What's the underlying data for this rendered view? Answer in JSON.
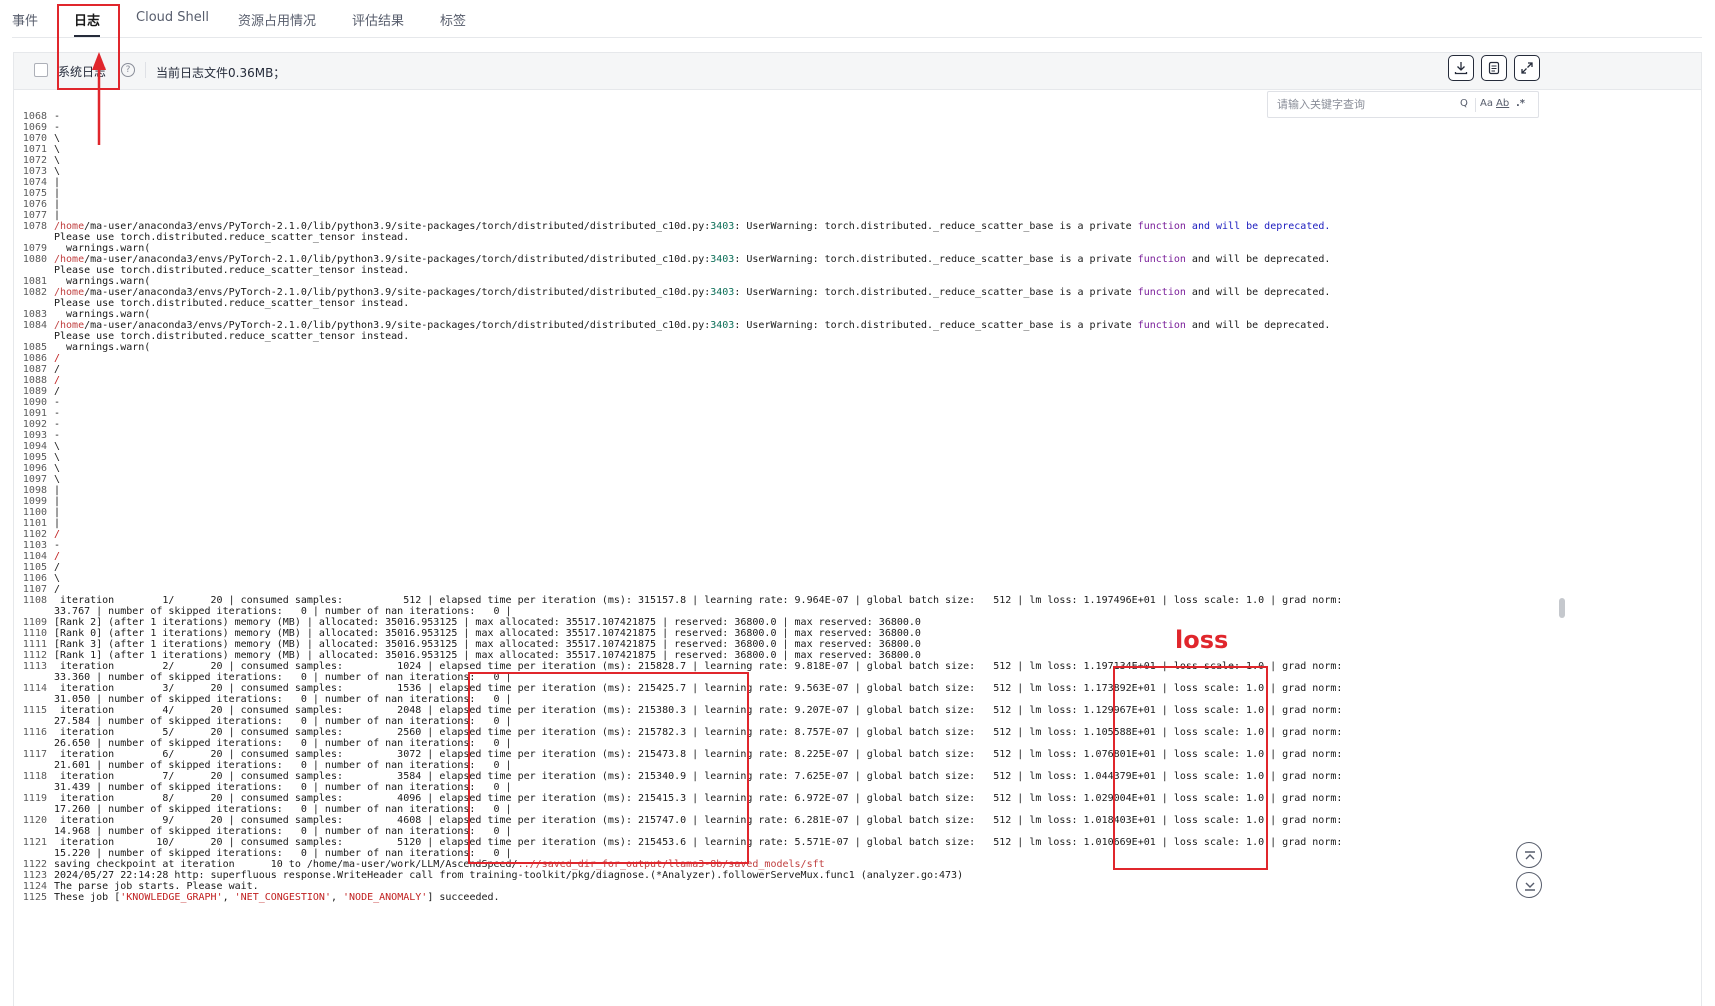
{
  "tabs": [
    "事件",
    "日志",
    "Cloud Shell",
    "资源占用情况",
    "评估结果",
    "标签"
  ],
  "active_tab": "日志",
  "toolbar": {
    "system_log_label": "系统日志",
    "help_icon": "?",
    "log_size_label": "当前日志文件0.36MB；",
    "download_icon": "download-icon",
    "copy_icon": "copy-icon",
    "fullscreen_icon": "fullscreen-icon"
  },
  "search": {
    "placeholder": "请输入关键字查询",
    "search_icon": "Q",
    "match_case_label": "Aa",
    "whole_word_label": "Ab",
    "regex_label": ".*"
  },
  "annotation": {
    "loss_label": "loss",
    "highlight_color": "#e0262c"
  },
  "log_lines": [
    {
      "n": "1068",
      "t": "-"
    },
    {
      "n": "1069",
      "t": "-"
    },
    {
      "n": "1070",
      "t": "\\"
    },
    {
      "n": "1071",
      "t": "\\"
    },
    {
      "n": "1072",
      "t": "\\"
    },
    {
      "n": "1073",
      "t": "\\"
    },
    {
      "n": "1074",
      "t": "|"
    },
    {
      "n": "1075",
      "t": "|"
    },
    {
      "n": "1076",
      "t": "|"
    },
    {
      "n": "1077",
      "t": "|"
    },
    {
      "n": "1078",
      "t": "/home/ma-user/anaconda3/envs/PyTorch-2.1.0/lib/python3.9/site-packages/torch/distributed/distributed_c10d.py:3403: UserWarning: torch.distributed._reduce_scatter_base is a private function and will be deprecated.",
      "kind": "warn_full"
    },
    {
      "n": "",
      "t": "Please use torch.distributed.reduce_scatter_tensor instead."
    },
    {
      "n": "1079",
      "t": "  warnings.warn("
    },
    {
      "n": "1080",
      "t": "/home/ma-user/anaconda3/envs/PyTorch-2.1.0/lib/python3.9/site-packages/torch/distributed/distributed_c10d.py:3403: UserWarning: torch.distributed._reduce_scatter_base is a private function and will be deprecated.",
      "kind": "warn"
    },
    {
      "n": "",
      "t": "Please use torch.distributed.reduce_scatter_tensor instead."
    },
    {
      "n": "1081",
      "t": "  warnings.warn("
    },
    {
      "n": "1082",
      "t": "/home/ma-user/anaconda3/envs/PyTorch-2.1.0/lib/python3.9/site-packages/torch/distributed/distributed_c10d.py:3403: UserWarning: torch.distributed._reduce_scatter_base is a private function and will be deprecated.",
      "kind": "warn"
    },
    {
      "n": "",
      "t": "Please use torch.distributed.reduce_scatter_tensor instead."
    },
    {
      "n": "1083",
      "t": "  warnings.warn("
    },
    {
      "n": "1084",
      "t": "/home/ma-user/anaconda3/envs/PyTorch-2.1.0/lib/python3.9/site-packages/torch/distributed/distributed_c10d.py:3403: UserWarning: torch.distributed._reduce_scatter_base is a private function and will be deprecated.",
      "kind": "warn"
    },
    {
      "n": "",
      "t": "Please use torch.distributed.reduce_scatter_tensor instead."
    },
    {
      "n": "1085",
      "t": "  warnings.warn("
    },
    {
      "n": "1086",
      "t": "/",
      "kind": "red"
    },
    {
      "n": "1087",
      "t": "/"
    },
    {
      "n": "1088",
      "t": "/",
      "kind": "red"
    },
    {
      "n": "1089",
      "t": "/"
    },
    {
      "n": "1090",
      "t": "-"
    },
    {
      "n": "1091",
      "t": "-"
    },
    {
      "n": "1092",
      "t": "-"
    },
    {
      "n": "1093",
      "t": "-"
    },
    {
      "n": "1094",
      "t": "\\"
    },
    {
      "n": "1095",
      "t": "\\"
    },
    {
      "n": "1096",
      "t": "\\"
    },
    {
      "n": "1097",
      "t": "\\"
    },
    {
      "n": "1098",
      "t": "|"
    },
    {
      "n": "1099",
      "t": "|"
    },
    {
      "n": "1100",
      "t": "|"
    },
    {
      "n": "1101",
      "t": "|"
    },
    {
      "n": "1102",
      "t": "/",
      "kind": "red"
    },
    {
      "n": "1103",
      "t": "-"
    },
    {
      "n": "1104",
      "t": "/",
      "kind": "red"
    },
    {
      "n": "1105",
      "t": "/"
    },
    {
      "n": "1106",
      "t": "\\"
    },
    {
      "n": "1107",
      "t": "/"
    },
    {
      "n": "1108",
      "t": " iteration        1/      20 | consumed samples:          512 | elapsed time per iteration (ms): 315157.8 | learning rate: 9.964E-07 | global batch size:   512 | lm loss: 1.197496E+01 | loss scale: 1.0 | grad norm:"
    },
    {
      "n": "",
      "t": "33.767 | number of skipped iterations:   0 | number of nan iterations:   0 |"
    },
    {
      "n": "1109",
      "t": "[Rank 2] (after 1 iterations) memory (MB) | allocated: 35016.953125 | max allocated: 35517.107421875 | reserved: 36800.0 | max reserved: 36800.0"
    },
    {
      "n": "1110",
      "t": "[Rank 0] (after 1 iterations) memory (MB) | allocated: 35016.953125 | max allocated: 35517.107421875 | reserved: 36800.0 | max reserved: 36800.0"
    },
    {
      "n": "1111",
      "t": "[Rank 3] (after 1 iterations) memory (MB) | allocated: 35016.953125 | max allocated: 35517.107421875 | reserved: 36800.0 | max reserved: 36800.0"
    },
    {
      "n": "1112",
      "t": "[Rank 1] (after 1 iterations) memory (MB) | allocated: 35016.953125 | max allocated: 35517.107421875 | reserved: 36800.0 | max reserved: 36800.0"
    },
    {
      "n": "1113",
      "t": " iteration        2/      20 | consumed samples:         1024 | elapsed time per iteration (ms): 215828.7 | learning rate: 9.818E-07 | global batch size:   512 | lm loss: 1.197134E+01 | loss scale: 1.0 | grad norm:"
    },
    {
      "n": "",
      "t": "33.360 | number of skipped iterations:   0 | number of nan iterations:   0 |"
    },
    {
      "n": "1114",
      "t": " iteration        3/      20 | consumed samples:         1536 | elapsed time per iteration (ms): 215425.7 | learning rate: 9.563E-07 | global batch size:   512 | lm loss: 1.173892E+01 | loss scale: 1.0 | grad norm:"
    },
    {
      "n": "",
      "t": "31.050 | number of skipped iterations:   0 | number of nan iterations:   0 |"
    },
    {
      "n": "1115",
      "t": " iteration        4/      20 | consumed samples:         2048 | elapsed time per iteration (ms): 215380.3 | learning rate: 9.207E-07 | global batch size:   512 | lm loss: 1.129967E+01 | loss scale: 1.0 | grad norm:"
    },
    {
      "n": "",
      "t": "27.584 | number of skipped iterations:   0 | number of nan iterations:   0 |"
    },
    {
      "n": "1116",
      "t": " iteration        5/      20 | consumed samples:         2560 | elapsed time per iteration (ms): 215782.3 | learning rate: 8.757E-07 | global batch size:   512 | lm loss: 1.105588E+01 | loss scale: 1.0 | grad norm:"
    },
    {
      "n": "",
      "t": "26.650 | number of skipped iterations:   0 | number of nan iterations:   0 |"
    },
    {
      "n": "1117",
      "t": " iteration        6/      20 | consumed samples:         3072 | elapsed time per iteration (ms): 215473.8 | learning rate: 8.225E-07 | global batch size:   512 | lm loss: 1.076801E+01 | loss scale: 1.0 | grad norm:"
    },
    {
      "n": "",
      "t": "21.601 | number of skipped iterations:   0 | number of nan iterations:   0 |"
    },
    {
      "n": "1118",
      "t": " iteration        7/      20 | consumed samples:         3584 | elapsed time per iteration (ms): 215340.9 | learning rate: 7.625E-07 | global batch size:   512 | lm loss: 1.044379E+01 | loss scale: 1.0 | grad norm:"
    },
    {
      "n": "",
      "t": "31.439 | number of skipped iterations:   0 | number of nan iterations:   0 |"
    },
    {
      "n": "1119",
      "t": " iteration        8/      20 | consumed samples:         4096 | elapsed time per iteration (ms): 215415.3 | learning rate: 6.972E-07 | global batch size:   512 | lm loss: 1.029004E+01 | loss scale: 1.0 | grad norm:"
    },
    {
      "n": "",
      "t": "17.260 | number of skipped iterations:   0 | number of nan iterations:   0 |"
    },
    {
      "n": "1120",
      "t": " iteration        9/      20 | consumed samples:         4608 | elapsed time per iteration (ms): 215747.0 | learning rate: 6.281E-07 | global batch size:   512 | lm loss: 1.018403E+01 | loss scale: 1.0 | grad norm:"
    },
    {
      "n": "",
      "t": "14.968 | number of skipped iterations:   0 | number of nan iterations:   0 |"
    },
    {
      "n": "1121",
      "t": " iteration       10/      20 | consumed samples:         5120 | elapsed time per iteration (ms): 215453.6 | learning rate: 5.571E-07 | global batch size:   512 | lm loss: 1.010669E+01 | loss scale: 1.0 | grad norm:"
    },
    {
      "n": "",
      "t": "15.220 | number of skipped iterations:   0 | number of nan iterations:   0 |"
    },
    {
      "n": "1122",
      "t": "saving checkpoint at iteration      10 to /home/ma-user/work/LLM/AscendSpeed/..//saved_dir_for_output/llama3-8b/saved_models/sft",
      "kind": "save"
    },
    {
      "n": "1123",
      "t": "2024/05/27 22:14:28 http: superfluous response.WriteHeader call from training-toolkit/pkg/diagnose.(*Analyzer).followerServeMux.func1 (analyzer.go:473)"
    },
    {
      "n": "1124",
      "t": "The parse job starts. Please wait."
    },
    {
      "n": "1125",
      "t": "These job ['KNOWLEDGE_GRAPH', 'NET_CONGESTION', 'NODE_ANOMALY'] succeeded.",
      "kind": "jobs"
    }
  ]
}
